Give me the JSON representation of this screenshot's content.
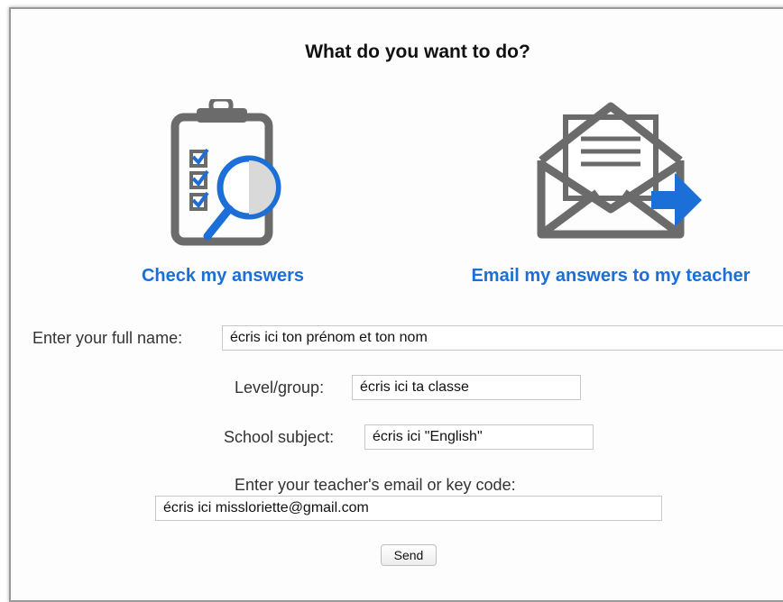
{
  "title": "What do you want to do?",
  "options": {
    "check": {
      "label": "Check my answers",
      "icon": "clipboard-checklist-magnifier-icon"
    },
    "email": {
      "label": "Email my answers to my teacher",
      "icon": "envelope-letter-arrow-icon"
    }
  },
  "form": {
    "full_name": {
      "label": "Enter your full name:",
      "value": "écris ici ton prénom et ton nom"
    },
    "level_group": {
      "label": "Level/group:",
      "value": "écris ici ta classe"
    },
    "school_subject": {
      "label": "School subject:",
      "value": "écris ici \"English\""
    },
    "teacher_email": {
      "label": "Enter your teacher's email or key code:",
      "value": "écris ici missloriette@gmail.com"
    },
    "send_label": "Send"
  },
  "colors": {
    "accent": "#1c6fd6",
    "icon_gray": "#6b6b6b"
  }
}
